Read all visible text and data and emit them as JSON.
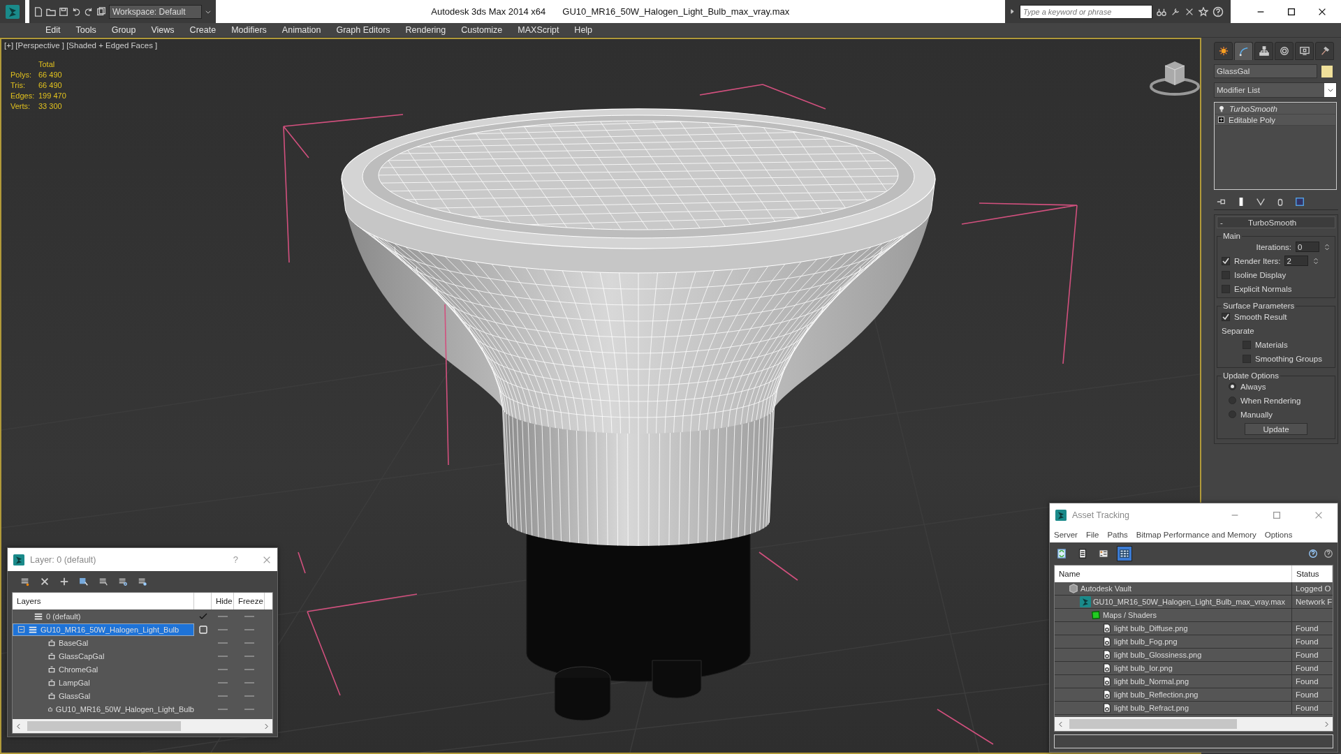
{
  "title_bar": {
    "workspace": "Workspace: Default",
    "app_title": "Autodesk 3ds Max  2014 x64",
    "file_name": "GU10_MR16_50W_Halogen_Light_Bulb_max_vray.max",
    "search": {
      "placeholder": "Type a keyword or phrase"
    }
  },
  "menu": [
    "Edit",
    "Tools",
    "Group",
    "Views",
    "Create",
    "Modifiers",
    "Animation",
    "Graph Editors",
    "Rendering",
    "Customize",
    "MAXScript",
    "Help"
  ],
  "viewport": {
    "label": "[+] [Perspective ] [Shaded + Edged Faces ]",
    "stats_title": "Total",
    "stats": [
      {
        "label": "Polys:",
        "value": "66 490"
      },
      {
        "label": "Tris:",
        "value": "66 490"
      },
      {
        "label": "Edges:",
        "value": "199 470"
      },
      {
        "label": "Verts:",
        "value": "33 300"
      }
    ]
  },
  "command_panel": {
    "tabs": [
      {
        "kind": "create",
        "selected": false
      },
      {
        "kind": "modify",
        "selected": true
      },
      {
        "kind": "hierarchy",
        "selected": false
      },
      {
        "kind": "motion",
        "selected": false
      },
      {
        "kind": "display",
        "selected": false
      },
      {
        "kind": "utilities",
        "selected": false
      }
    ],
    "object_name": "GlassGal",
    "modifier_list": "Modifier List",
    "stack": [
      {
        "kind": "modifier",
        "name": "TurboSmooth"
      },
      {
        "kind": "base",
        "name": "Editable Poly"
      }
    ],
    "rollout": {
      "collapse": "-",
      "title": "TurboSmooth",
      "groups": [
        {
          "title": "Main",
          "controls": [
            {
              "kind": "spinner",
              "label": "Iterations:",
              "value": "0"
            },
            {
              "kind": "check_spinner",
              "label": "Render Iters:",
              "checked": true,
              "value": "2"
            },
            {
              "kind": "checkbox",
              "label": "Isoline Display",
              "checked": false
            },
            {
              "kind": "checkbox",
              "label": "Explicit Normals",
              "checked": false
            }
          ]
        },
        {
          "title": "Surface Parameters",
          "controls": [
            {
              "kind": "checkbox",
              "label": "Smooth Result",
              "checked": true
            },
            {
              "kind": "text",
              "label": "Separate"
            },
            {
              "kind": "subcheckbox",
              "label": "Materials",
              "checked": false
            },
            {
              "kind": "subcheckbox",
              "label": "Smoothing Groups",
              "checked": false
            }
          ]
        },
        {
          "title": "Update Options",
          "controls": [
            {
              "kind": "radio",
              "label": "Always",
              "selected": true
            },
            {
              "kind": "radio",
              "label": "When Rendering",
              "selected": false
            },
            {
              "kind": "radio",
              "label": "Manually",
              "selected": false
            },
            {
              "kind": "button",
              "label": "Update"
            }
          ]
        }
      ]
    }
  },
  "layer_window": {
    "title": "Layer: 0 (default)",
    "help": "?",
    "columns": [
      "Layers",
      "Hide",
      "Freeze"
    ],
    "layers": [
      {
        "name": "0 (default)",
        "current": true,
        "selected": false
      },
      {
        "name": "GU10_MR16_50W_Halogen_Light_Bulb",
        "current": false,
        "selected": true,
        "expanded": true,
        "children": [
          {
            "name": "BaseGal"
          },
          {
            "name": "GlassCapGal"
          },
          {
            "name": "ChromeGal"
          },
          {
            "name": "LampGal"
          },
          {
            "name": "GlassGal"
          },
          {
            "name": "GU10_MR16_50W_Halogen_Light_Bulb"
          }
        ]
      }
    ]
  },
  "asset_window": {
    "title": "Asset Tracking",
    "menu": [
      "Server",
      "File",
      "Paths",
      "Bitmap Performance and Memory",
      "Options"
    ],
    "toolbar": [
      {
        "kind": "refresh",
        "selected": false
      },
      {
        "kind": "list",
        "selected": false
      },
      {
        "kind": "thumbnails",
        "selected": false
      },
      {
        "kind": "table",
        "selected": true
      }
    ],
    "columns": [
      "Name",
      "Status"
    ],
    "rows": [
      {
        "kind": "vault",
        "name": "Autodesk Vault",
        "status": "Logged O",
        "children": [
          {
            "kind": "scene",
            "name": "GU10_MR16_50W_Halogen_Light_Bulb_max_vray.max",
            "status": "Network F",
            "children": [
              {
                "kind": "folder",
                "name": "Maps / Shaders",
                "children": [
                  {
                    "kind": "bitmap",
                    "name": "light bulb_Diffuse.png",
                    "status": "Found"
                  },
                  {
                    "kind": "bitmap",
                    "name": "light bulb_Fog.png",
                    "status": "Found"
                  },
                  {
                    "kind": "bitmap",
                    "name": "light bulb_Glossiness.png",
                    "status": "Found"
                  },
                  {
                    "kind": "bitmap",
                    "name": "light bulb_Ior.png",
                    "status": "Found"
                  },
                  {
                    "kind": "bitmap",
                    "name": "light bulb_Normal.png",
                    "status": "Found"
                  },
                  {
                    "kind": "bitmap",
                    "name": "light bulb_Reflection.png",
                    "status": "Found"
                  },
                  {
                    "kind": "bitmap",
                    "name": "light bulb_Refract.png",
                    "status": "Found"
                  }
                ]
              }
            ]
          }
        ]
      }
    ]
  }
}
